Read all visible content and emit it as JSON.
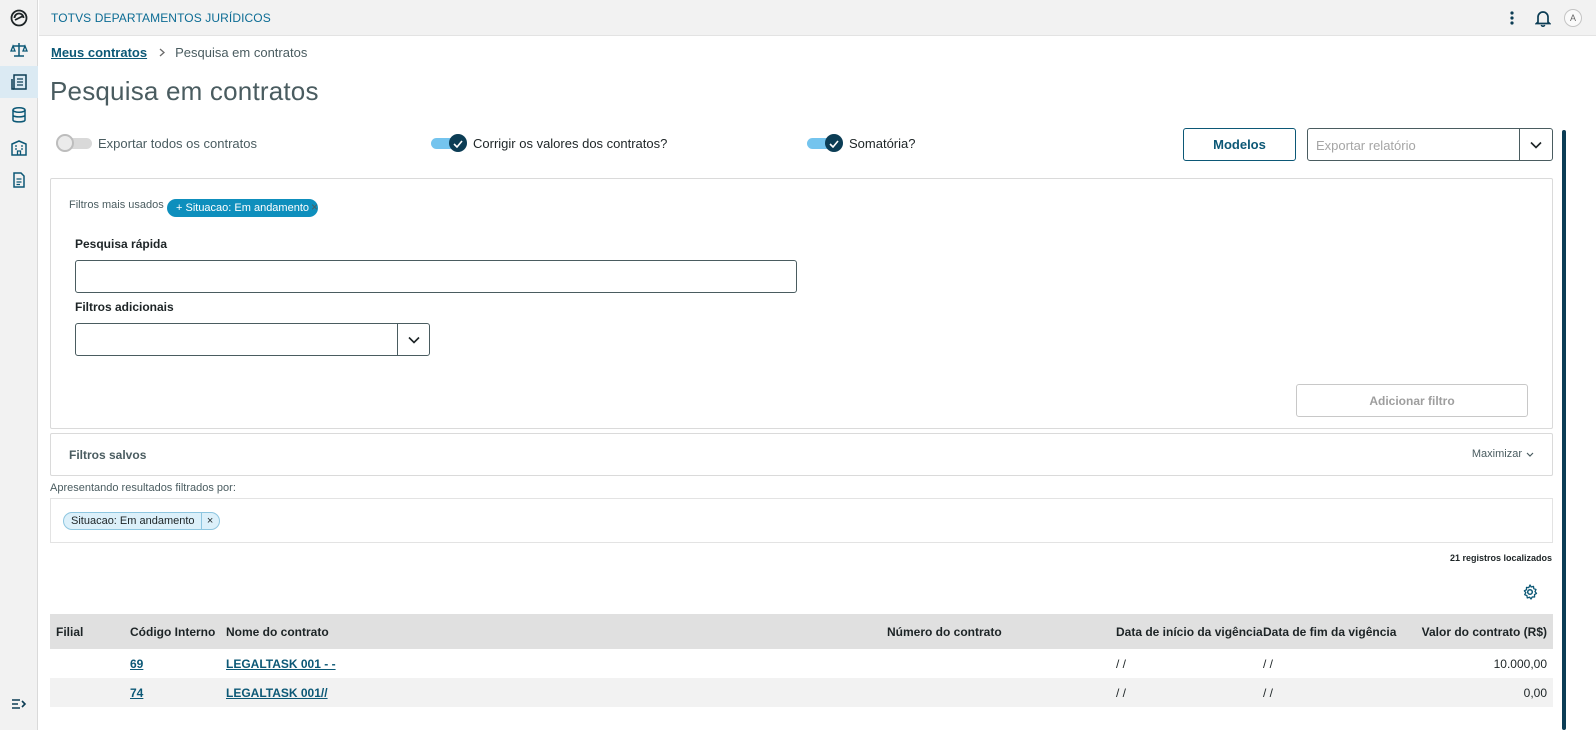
{
  "app": {
    "title": "TOTVS DEPARTAMENTOS JURÍDICOS",
    "avatar_initial": "A"
  },
  "rail": {
    "items": [
      {
        "icon": "logo-icon"
      },
      {
        "icon": "scales-icon"
      },
      {
        "icon": "contracts-icon",
        "active": true
      },
      {
        "icon": "database-icon"
      },
      {
        "icon": "building-icon"
      },
      {
        "icon": "document-icon"
      }
    ],
    "bottom_icon": "expand-menu-icon"
  },
  "breadcrumb": {
    "parent": "Meus contratos",
    "current": "Pesquisa em contratos"
  },
  "page_title": "Pesquisa em contratos",
  "switches": {
    "export_all": {
      "label": "Exportar todos os contratos",
      "on": false
    },
    "correct_values": {
      "label": "Corrigir os valores dos contratos?",
      "on": true
    },
    "sum": {
      "label": "Somatória?",
      "on": true
    }
  },
  "toolbar": {
    "models_label": "Modelos",
    "export_placeholder": "Exportar relatório"
  },
  "filters": {
    "most_used_label": "Filtros mais usados",
    "most_used_chip": "+ Situacao: Em andamento",
    "chip_close": "×",
    "quick_search_label": "Pesquisa rápida",
    "quick_search_value": "",
    "extra_filters_label": "Filtros adicionais",
    "add_filter_label": "Adicionar filtro"
  },
  "saved_filters": {
    "title": "Filtros salvos",
    "maximize_label": "Maximizar"
  },
  "results": {
    "label": "Apresentando resultados filtrados por:",
    "applied_chip": "Situacao: Em andamento",
    "chip_close": "×",
    "count_text": "21 registros localizados"
  },
  "table": {
    "headers": [
      "Filial",
      "Código Interno",
      "Nome do contrato",
      "Número do contrato",
      "Data de início da vigência",
      "Data de fim da vigência",
      "Valor do contrato (R$)"
    ],
    "rows": [
      {
        "filial": "",
        "codigo": "69",
        "nome": "LEGALTASK 001 - -",
        "numero": "",
        "inicio": "/ /",
        "fim": "/ /",
        "valor": "10.000,00"
      },
      {
        "filial": "",
        "codigo": "74",
        "nome": "LEGALTASK 001//",
        "numero": "",
        "inicio": "/ /",
        "fim": "/ /",
        "valor": "0,00"
      }
    ]
  },
  "colors": {
    "primary": "#0c5876",
    "accent": "#0e8fbd",
    "switch_track": "#74c4ee",
    "switch_knob": "#0c3d55"
  }
}
